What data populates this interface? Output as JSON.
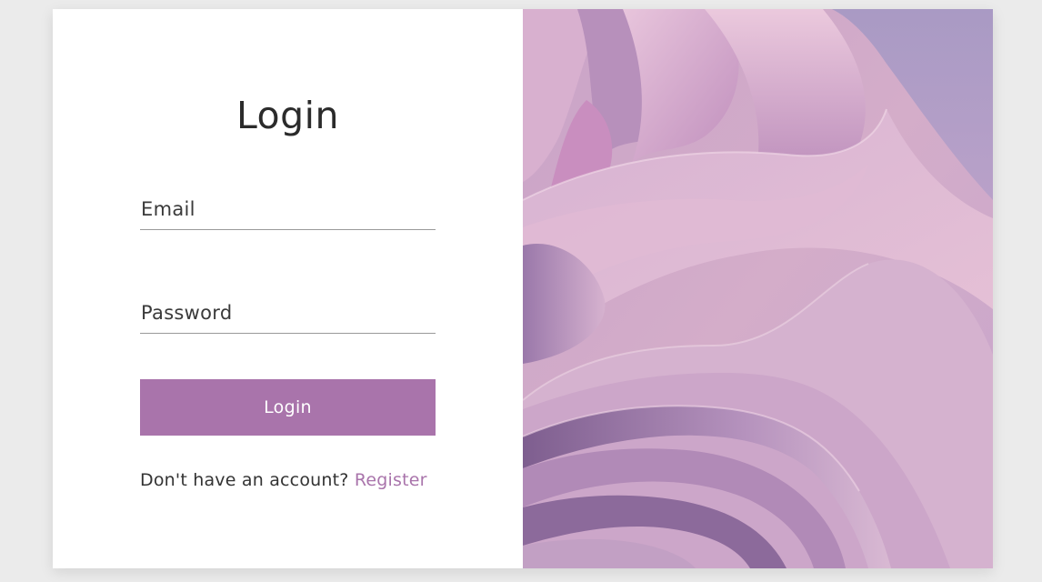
{
  "login_form": {
    "title": "Login",
    "email_placeholder": "Email",
    "password_placeholder": "Password",
    "submit_label": "Login",
    "register_prompt": "Don't have an account?",
    "register_link": "Register"
  },
  "colors": {
    "accent": "#a974ab",
    "page_background": "#ebebeb",
    "card_background": "#ffffff",
    "text": "#333333"
  },
  "decoration": {
    "image_description_name": "abstract-pink-waves-image"
  }
}
